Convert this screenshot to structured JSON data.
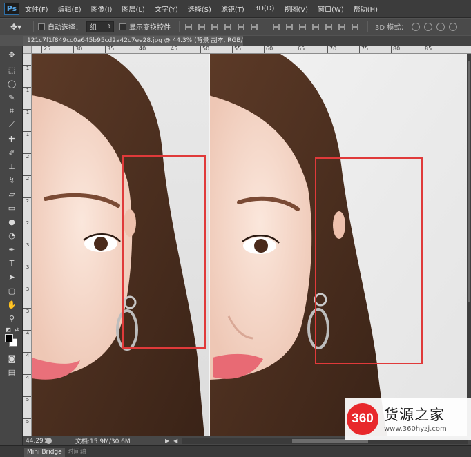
{
  "app": {
    "logo": "Ps"
  },
  "menu": [
    "文件(F)",
    "编辑(E)",
    "图像(I)",
    "图层(L)",
    "文字(Y)",
    "选择(S)",
    "滤镜(T)",
    "3D(D)",
    "视图(V)",
    "窗口(W)",
    "帮助(H)"
  ],
  "options": {
    "auto_select_label": "自动选择：",
    "auto_select_value": "组",
    "show_transform_label": "显示变换控件",
    "mode_3d_label": "3D 模式："
  },
  "document": {
    "tab_title": "121c7f1f849cc0a645b95cd2a42c7ee28.jpg @ 44.3% (背景 副本, RGB/8#) *",
    "close": "×"
  },
  "ruler": {
    "h_ticks": [
      "25",
      "30",
      "35",
      "40",
      "45",
      "50",
      "55",
      "60",
      "65",
      "70",
      "75",
      "80",
      "85"
    ],
    "v_ticks": [
      "1",
      "1",
      "1",
      "1",
      "2",
      "2",
      "2",
      "2",
      "3",
      "3",
      "3",
      "3",
      "4",
      "4",
      "4",
      "5",
      "5"
    ]
  },
  "status": {
    "zoom": "44.29%",
    "doc_info": "文档:15.9M/30.6M"
  },
  "bottom_tabs": [
    "Mini Bridge",
    "时间轴"
  ],
  "watermark": {
    "logo_text": "360",
    "name": "货源之家",
    "url": "www.360hyzj.com"
  },
  "colors": {
    "highlight_box": "#e03a3a",
    "foreground": "#000000",
    "background": "#ffffff"
  }
}
